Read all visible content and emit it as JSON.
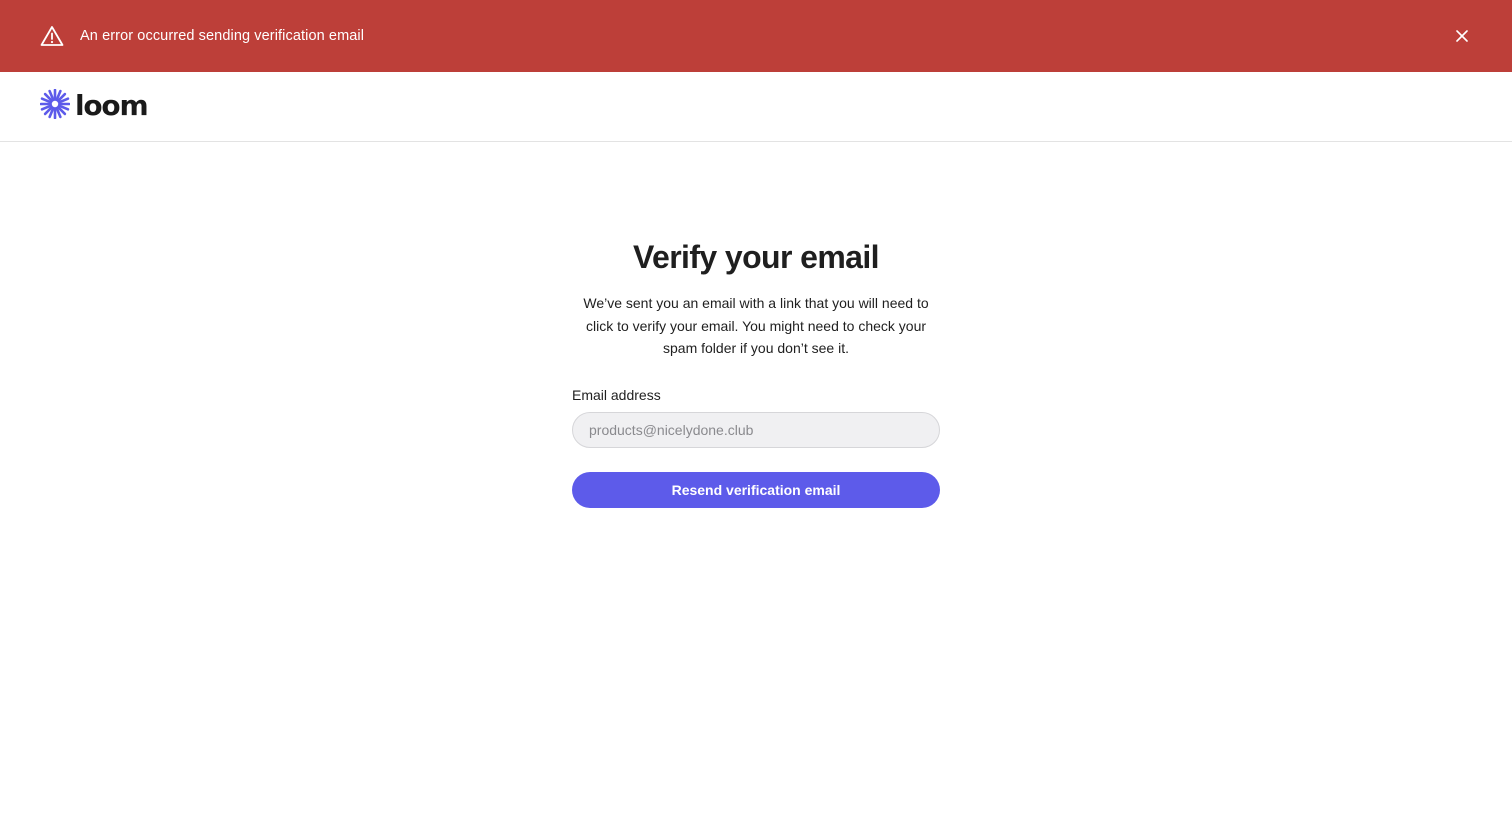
{
  "banner": {
    "message": "An error occurred sending verification email",
    "icon": "warning-triangle-icon",
    "close_icon": "close-icon",
    "background": "#bd3f39"
  },
  "header": {
    "logo_text": "loom",
    "logo_icon": "loom-burst-icon",
    "brand_color": "#5d5bea"
  },
  "main": {
    "title": "Verify your email",
    "description": "We’ve sent you an email with a link that you will need to click to verify your email. You might need to check your spam folder if you don’t see it.",
    "email_label": "Email address",
    "email_placeholder": "products@nicelydone.club",
    "email_value": "",
    "resend_label": "Resend verification email"
  }
}
